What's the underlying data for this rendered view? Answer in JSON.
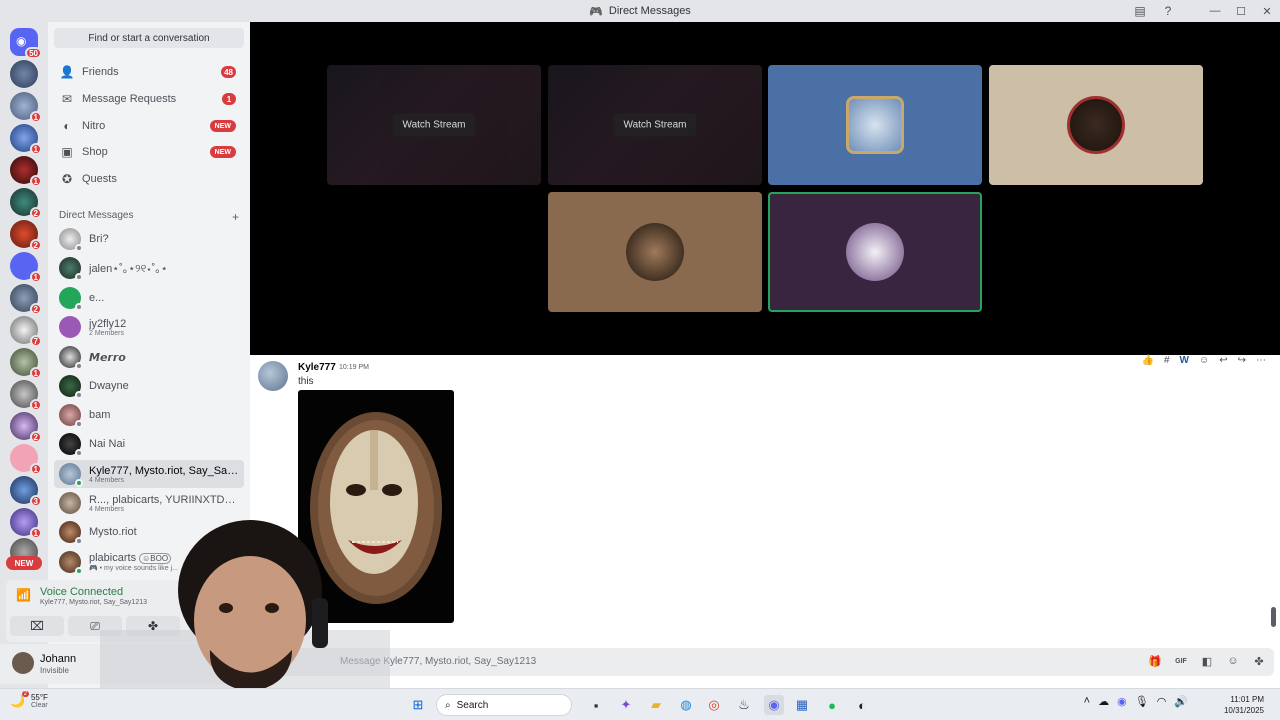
{
  "window": {
    "title": "Direct Messages"
  },
  "sidebar": {
    "search_label": "Find or start a conversation",
    "nav": [
      {
        "label": "Friends",
        "count": "48",
        "icon": "friends-icon"
      },
      {
        "label": "Message Requests",
        "count": "1",
        "icon": "envelope-icon"
      },
      {
        "label": "Nitro",
        "tag": "NEW",
        "icon": "nitro-icon"
      },
      {
        "label": "Shop",
        "tag": "NEW",
        "icon": "shop-icon"
      },
      {
        "label": "Quests",
        "icon": "quests-icon"
      }
    ],
    "dm_header": "Direct Messages",
    "dm_add": "+",
    "dms": [
      {
        "name": "Bri?"
      },
      {
        "name": "jalen⋆˚｡⋆୨୧⋆˚｡⋆"
      },
      {
        "name": "e..."
      },
      {
        "name": "jy2fly12",
        "sub": "2 Members"
      },
      {
        "name": "𝙈𝙚𝙧𝙧𝙤"
      },
      {
        "name": "Dwayne"
      },
      {
        "name": "bam"
      },
      {
        "name": "Nai Nai"
      },
      {
        "name": "Kyle777, Mysto.riot, Say_Say1...",
        "sub": "4 Members"
      },
      {
        "name": "R..., plabicarts, YURIINXTDO...",
        "sub": "4 Members"
      },
      {
        "name": "Mysto.riot"
      },
      {
        "name": "plabicarts",
        "status_tag": "☺BOO",
        "sub": "🎮 • my voice sounds like j..."
      }
    ]
  },
  "rail": {
    "home_badge": "50",
    "badges": [
      "1",
      "1",
      "1",
      "2",
      "2",
      "1",
      "2",
      "7",
      "1",
      "1",
      "2",
      "1",
      "3",
      "1"
    ],
    "new_label": "NEW"
  },
  "voice": {
    "status": "Voice Connected",
    "channel": "Kyle777, Mysto.riot, Say_Say1213"
  },
  "user": {
    "name": "Johann",
    "status": "Invisible"
  },
  "stage": {
    "watch_label": "Watch Stream"
  },
  "chat": {
    "message": {
      "author": "Kyle777",
      "time": "10:19 PM",
      "text": "this"
    },
    "composer_placeholder": "Message Kyle777, Mysto.riot, Say_Say1213"
  },
  "taskbar": {
    "temp": "55°F",
    "condition": "Clear",
    "weather_badge": "2",
    "search": "Search",
    "time": "11:01 PM",
    "date": "10/31/2025"
  },
  "colors": {
    "accent": "#5865f2",
    "online": "#23a55a",
    "danger": "#d83c3e",
    "voice": "#248046"
  }
}
